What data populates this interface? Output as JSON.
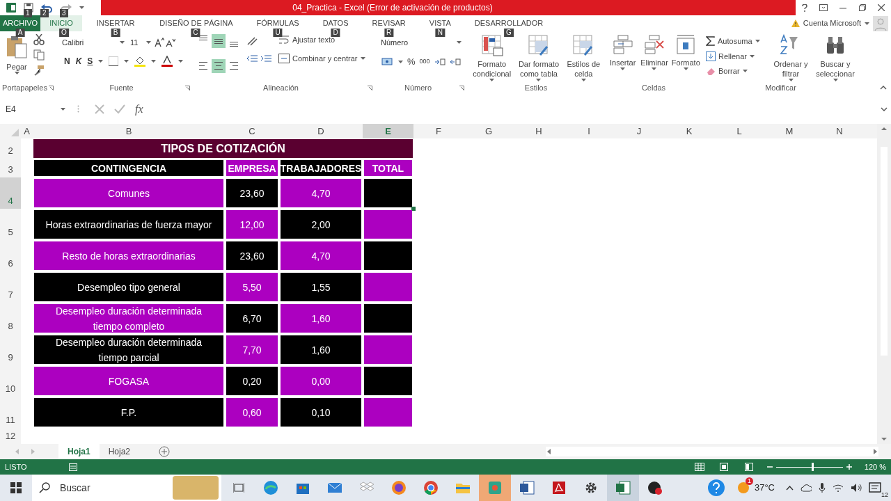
{
  "title_bar": {
    "quick_access_keytips": [
      "1",
      "2",
      "3"
    ],
    "title": "04_Practica -  Excel (Error de activación de productos)"
  },
  "ribbon_tabs": [
    {
      "label": "ARCHIVO",
      "keytip": "A",
      "kind": "file",
      "selected": false
    },
    {
      "label": "INICIO",
      "keytip": "O",
      "kind": "tab",
      "selected": true
    },
    {
      "label": "INSERTAR",
      "keytip": "B",
      "kind": "tab",
      "selected": false
    },
    {
      "label": "DISEÑO DE PÁGINA",
      "keytip": "C",
      "kind": "tab",
      "selected": false
    },
    {
      "label": "FÓRMULAS",
      "keytip": "U",
      "kind": "tab",
      "selected": false
    },
    {
      "label": "DATOS",
      "keytip": "D",
      "kind": "tab",
      "selected": false
    },
    {
      "label": "REVISAR",
      "keytip": "R",
      "kind": "tab",
      "selected": false
    },
    {
      "label": "VISTA",
      "keytip": "N",
      "kind": "tab",
      "selected": false
    },
    {
      "label": "DESARROLLADOR",
      "keytip": "G",
      "kind": "tab",
      "selected": false
    }
  ],
  "account": {
    "label": "Cuenta Microsoft"
  },
  "ribbon": {
    "clipboard": {
      "label": "Portapapeles",
      "paste": "Pegar"
    },
    "font": {
      "label": "Fuente",
      "name": "Calibri",
      "size": "11",
      "bold": "N",
      "italic": "K",
      "underline": "S"
    },
    "alignment": {
      "label": "Alineación",
      "align_buttons": [
        {
          "selected": false
        },
        {
          "selected": true
        },
        {
          "selected": false
        },
        {
          "selected": false
        },
        {
          "selected": true
        },
        {
          "selected": false
        }
      ],
      "wrap": "Ajustar texto",
      "merge": "Combinar y centrar"
    },
    "number": {
      "label": "Número",
      "format": "Número",
      "percent": "%",
      "thousands": "000"
    },
    "styles": {
      "label": "Estilos",
      "buttons": [
        "Formato condicional",
        "Dar formato como tabla",
        "Estilos de celda"
      ]
    },
    "cells": {
      "label": "Celdas",
      "buttons": [
        "Insertar",
        "Eliminar",
        "Formato"
      ]
    },
    "editing": {
      "label": "Modificar",
      "small_buttons": [
        "Autosuma",
        "Rellenar",
        "Borrar"
      ],
      "buttons": [
        "Ordenar y filtrar",
        "Buscar y seleccionar"
      ]
    }
  },
  "formula_bar": {
    "name_box": "E4",
    "function_button": "fx"
  },
  "columns": [
    {
      "label": "A",
      "selected": false
    },
    {
      "label": "B",
      "selected": false
    },
    {
      "label": "C",
      "selected": false
    },
    {
      "label": "D",
      "selected": false
    },
    {
      "label": "E",
      "selected": true
    },
    {
      "label": "F",
      "selected": false
    },
    {
      "label": "G",
      "selected": false
    },
    {
      "label": "H",
      "selected": false
    },
    {
      "label": "I",
      "selected": false
    },
    {
      "label": "J",
      "selected": false
    },
    {
      "label": "K",
      "selected": false
    },
    {
      "label": "L",
      "selected": false
    },
    {
      "label": "M",
      "selected": false
    },
    {
      "label": "N",
      "selected": false
    }
  ],
  "table": {
    "title_row": "2",
    "title": "TIPOS DE COTIZACIÓN",
    "header_row": "3",
    "headers": [
      {
        "text": "CONTINGENCIA",
        "color": "#000000"
      },
      {
        "text": "EMPRESA",
        "color": "#ac00c0"
      },
      {
        "text": "TRABAJADORES",
        "color": "#000000"
      },
      {
        "text": "TOTAL",
        "color": "#ac00c0"
      }
    ],
    "rows": [
      {
        "number": "4",
        "selected": true,
        "cells": [
          {
            "text": "Comunes",
            "color": "#ac00c0",
            "selected": false
          },
          {
            "text": "23,60",
            "color": "#000000",
            "selected": false
          },
          {
            "text": "4,70",
            "color": "#ac00c0",
            "selected": false
          },
          {
            "color": "#000000",
            "selected": true
          }
        ]
      },
      {
        "number": "5",
        "selected": false,
        "cells": [
          {
            "text": "Horas extraordinarias de fuerza mayor",
            "color": "#000000",
            "selected": false
          },
          {
            "text": "12,00",
            "color": "#ac00c0",
            "selected": false
          },
          {
            "text": "2,00",
            "color": "#000000",
            "selected": false
          },
          {
            "color": "#ac00c0",
            "selected": false
          }
        ]
      },
      {
        "number": "6",
        "selected": false,
        "cells": [
          {
            "text": "Resto de horas extraordinarias",
            "color": "#ac00c0",
            "selected": false
          },
          {
            "text": "23,60",
            "color": "#000000",
            "selected": false
          },
          {
            "text": "4,70",
            "color": "#ac00c0",
            "selected": false
          },
          {
            "color": "#000000",
            "selected": false
          }
        ]
      },
      {
        "number": "7",
        "selected": false,
        "cells": [
          {
            "text": "Desempleo tipo general",
            "color": "#000000",
            "selected": false
          },
          {
            "text": "5,50",
            "color": "#ac00c0",
            "selected": false
          },
          {
            "text": "1,55",
            "color": "#000000",
            "selected": false
          },
          {
            "color": "#ac00c0",
            "selected": false
          }
        ]
      },
      {
        "number": "8",
        "selected": false,
        "cells": [
          {
            "text": "Desempleo duración determinada tiempo completo",
            "color": "#ac00c0",
            "selected": false
          },
          {
            "text": "6,70",
            "color": "#000000",
            "selected": false
          },
          {
            "text": "1,60",
            "color": "#ac00c0",
            "selected": false
          },
          {
            "color": "#000000",
            "selected": false
          }
        ]
      },
      {
        "number": "9",
        "selected": false,
        "cells": [
          {
            "text": "Desempleo duración determinada tiempo parcial",
            "color": "#000000",
            "selected": false
          },
          {
            "text": "7,70",
            "color": "#ac00c0",
            "selected": false
          },
          {
            "text": "1,60",
            "color": "#000000",
            "selected": false
          },
          {
            "color": "#ac00c0",
            "selected": false
          }
        ]
      },
      {
        "number": "10",
        "selected": false,
        "cells": [
          {
            "text": "FOGASA",
            "color": "#ac00c0",
            "selected": false
          },
          {
            "text": "0,20",
            "color": "#000000",
            "selected": false
          },
          {
            "text": "0,00",
            "color": "#ac00c0",
            "selected": false
          },
          {
            "color": "#000000",
            "selected": false
          }
        ]
      },
      {
        "number": "11",
        "selected": false,
        "cells": [
          {
            "text": "F.P.",
            "color": "#000000",
            "selected": false
          },
          {
            "text": "0,60",
            "color": "#ac00c0",
            "selected": false
          },
          {
            "text": "0,10",
            "color": "#000000",
            "selected": false
          },
          {
            "color": "#ac00c0",
            "selected": false
          }
        ]
      }
    ],
    "empty_rows": [
      "12"
    ]
  },
  "sheet_tabs": [
    {
      "label": "Hoja1",
      "selected": true
    },
    {
      "label": "Hoja2",
      "selected": false
    }
  ],
  "status_bar": {
    "text": "LISTO",
    "zoom_slider": {
      "level": 0.54
    },
    "zoom": "120 %"
  },
  "taskbar": {
    "search": {
      "placeholder": "Buscar"
    },
    "weather_badge": "1",
    "temperature": "37°C",
    "notification_count": "12"
  }
}
